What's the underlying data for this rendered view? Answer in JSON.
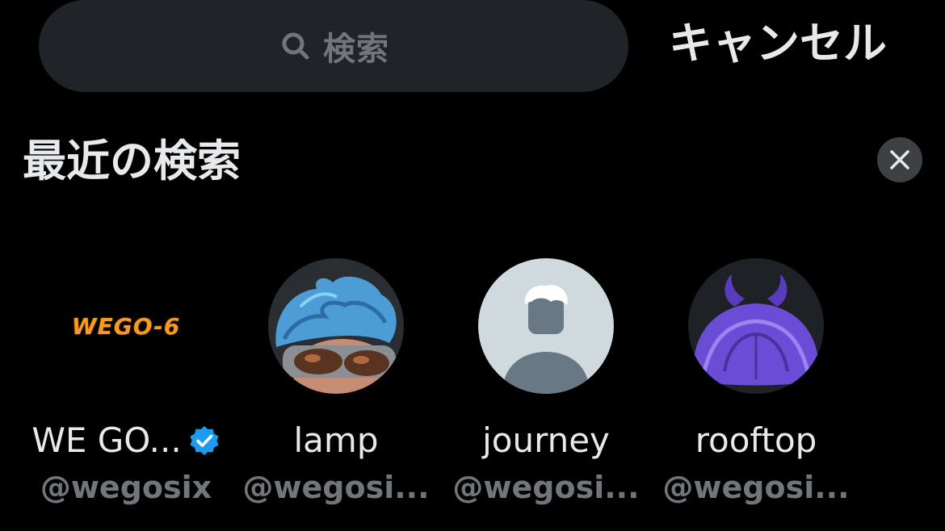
{
  "search": {
    "placeholder": "検索",
    "icon": "search-icon"
  },
  "header": {
    "cancel_label": "キャンセル"
  },
  "recent": {
    "title": "最近の検索",
    "clear_icon": "close-icon",
    "items": [
      {
        "name": "WE GO...",
        "handle": "@wegosix",
        "verified": true,
        "avatar": "wego-6-logo",
        "logo_text": "WEGO-6"
      },
      {
        "name": "lamp",
        "handle": "@wegosi...",
        "verified": false,
        "avatar": "blue-hair-goggles-avatar"
      },
      {
        "name": "journey",
        "handle": "@wegosi...",
        "verified": false,
        "avatar": "default-person-avatar"
      },
      {
        "name": "rooftop",
        "handle": "@wegosi...",
        "verified": false,
        "avatar": "purple-hair-horns-avatar"
      }
    ]
  },
  "colors": {
    "background": "#000000",
    "search_bg": "#202327",
    "text_primary": "#e7e9ea",
    "text_secondary": "#71767b",
    "verified": "#1d9bf0",
    "logo_orange": "#f39c1f"
  }
}
